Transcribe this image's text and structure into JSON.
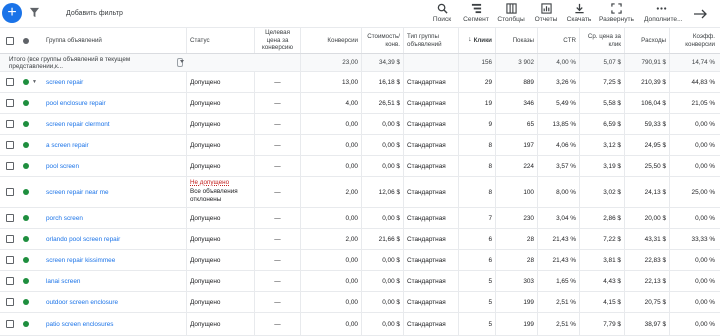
{
  "toolbar": {
    "filter_label": "Добавить фильтр",
    "items": [
      {
        "icon": "search-icon",
        "label": "Поиск"
      },
      {
        "icon": "segment-icon",
        "label": "Сегмент"
      },
      {
        "icon": "columns-icon",
        "label": "Столбцы"
      },
      {
        "icon": "reports-icon",
        "label": "Отчеты"
      },
      {
        "icon": "download-icon",
        "label": "Скачать"
      },
      {
        "icon": "expand-icon",
        "label": "Развернуть"
      },
      {
        "icon": "more-icon",
        "label": "Дополните..."
      }
    ]
  },
  "columns": {
    "name": "Группа объявлений",
    "status": "Статус",
    "target_cpa": "Целевая цена за конверсию",
    "conversions": "Конверсии",
    "cost_per_conv": "Стоимость/конв.",
    "type": "Тип группы объявлений",
    "clicks": "Клики",
    "impressions": "Показы",
    "ctr": "CTR",
    "avg_cpc": "Ср. цена за клик",
    "cost": "Расходы",
    "conv_rate": "Коэфф. конверсии"
  },
  "total": {
    "label": "Итого (все группы объявлений в текущем представлении,к...",
    "conversions": "23,00",
    "cost_per_conv": "34,39 $",
    "clicks": "156",
    "impressions": "3 902",
    "ctr": "4,00 %",
    "avg_cpc": "5,07 $",
    "cost": "790,91 $",
    "conv_rate": "14,74 %"
  },
  "rows": [
    {
      "name": "screen repair",
      "status": "Допущено",
      "target_cpa": "—",
      "conversions": "13,00",
      "cost_per_conv": "16,18 $",
      "type": "Стандартная",
      "clicks": "29",
      "impressions": "889",
      "ctr": "3,26 %",
      "avg_cpc": "7,25 $",
      "cost": "210,39 $",
      "conv_rate": "44,83 %"
    },
    {
      "name": "pool enclosure repair",
      "status": "Допущено",
      "target_cpa": "—",
      "conversions": "4,00",
      "cost_per_conv": "26,51 $",
      "type": "Стандартная",
      "clicks": "19",
      "impressions": "346",
      "ctr": "5,49 %",
      "avg_cpc": "5,58 $",
      "cost": "106,04 $",
      "conv_rate": "21,05 %"
    },
    {
      "name": "screen repair clermont",
      "status": "Допущено",
      "target_cpa": "—",
      "conversions": "0,00",
      "cost_per_conv": "0,00 $",
      "type": "Стандартная",
      "clicks": "9",
      "impressions": "65",
      "ctr": "13,85 %",
      "avg_cpc": "6,59 $",
      "cost": "59,33 $",
      "conv_rate": "0,00 %"
    },
    {
      "name": "a screen repair",
      "status": "Допущено",
      "target_cpa": "—",
      "conversions": "0,00",
      "cost_per_conv": "0,00 $",
      "type": "Стандартная",
      "clicks": "8",
      "impressions": "197",
      "ctr": "4,06 %",
      "avg_cpc": "3,12 $",
      "cost": "24,95 $",
      "conv_rate": "0,00 %"
    },
    {
      "name": "pool screen",
      "status": "Допущено",
      "target_cpa": "—",
      "conversions": "0,00",
      "cost_per_conv": "0,00 $",
      "type": "Стандартная",
      "clicks": "8",
      "impressions": "224",
      "ctr": "3,57 %",
      "avg_cpc": "3,19 $",
      "cost": "25,50 $",
      "conv_rate": "0,00 %"
    },
    {
      "name": "screen repair near me",
      "status_line1": "Не допущено",
      "status_line2": "Все объявления",
      "status_line3": "отклонены",
      "target_cpa": "—",
      "conversions": "2,00",
      "cost_per_conv": "12,06 $",
      "type": "Стандартная",
      "clicks": "8",
      "impressions": "100",
      "ctr": "8,00 %",
      "avg_cpc": "3,02 $",
      "cost": "24,13 $",
      "conv_rate": "25,00 %"
    },
    {
      "name": "porch screen",
      "status": "Допущено",
      "target_cpa": "—",
      "conversions": "0,00",
      "cost_per_conv": "0,00 $",
      "type": "Стандартная",
      "clicks": "7",
      "impressions": "230",
      "ctr": "3,04 %",
      "avg_cpc": "2,86 $",
      "cost": "20,00 $",
      "conv_rate": "0,00 %"
    },
    {
      "name": "orlando pool screen repair",
      "status": "Допущено",
      "target_cpa": "—",
      "conversions": "2,00",
      "cost_per_conv": "21,66 $",
      "type": "Стандартная",
      "clicks": "6",
      "impressions": "28",
      "ctr": "21,43 %",
      "avg_cpc": "7,22 $",
      "cost": "43,31 $",
      "conv_rate": "33,33 %"
    },
    {
      "name": "screen repair kissimmee",
      "status": "Допущено",
      "target_cpa": "—",
      "conversions": "0,00",
      "cost_per_conv": "0,00 $",
      "type": "Стандартная",
      "clicks": "6",
      "impressions": "28",
      "ctr": "21,43 %",
      "avg_cpc": "3,81 $",
      "cost": "22,83 $",
      "conv_rate": "0,00 %"
    },
    {
      "name": "lanai screen",
      "status": "Допущено",
      "target_cpa": "—",
      "conversions": "0,00",
      "cost_per_conv": "0,00 $",
      "type": "Стандартная",
      "clicks": "5",
      "impressions": "303",
      "ctr": "1,65 %",
      "avg_cpc": "4,43 $",
      "cost": "22,13 $",
      "conv_rate": "0,00 %"
    },
    {
      "name": "outdoor screen enclosure",
      "status": "Допущено",
      "target_cpa": "—",
      "conversions": "0,00",
      "cost_per_conv": "0,00 $",
      "type": "Стандартная",
      "clicks": "5",
      "impressions": "199",
      "ctr": "2,51 %",
      "avg_cpc": "4,15 $",
      "cost": "20,75 $",
      "conv_rate": "0,00 %"
    },
    {
      "name": "patio screen enclosures",
      "status": "Допущено",
      "target_cpa": "—",
      "conversions": "0,00",
      "cost_per_conv": "0,00 $",
      "type": "Стандартная",
      "clicks": "5",
      "impressions": "199",
      "ctr": "2,51 %",
      "avg_cpc": "7,79 $",
      "cost": "38,97 $",
      "conv_rate": "0,00 %"
    }
  ]
}
